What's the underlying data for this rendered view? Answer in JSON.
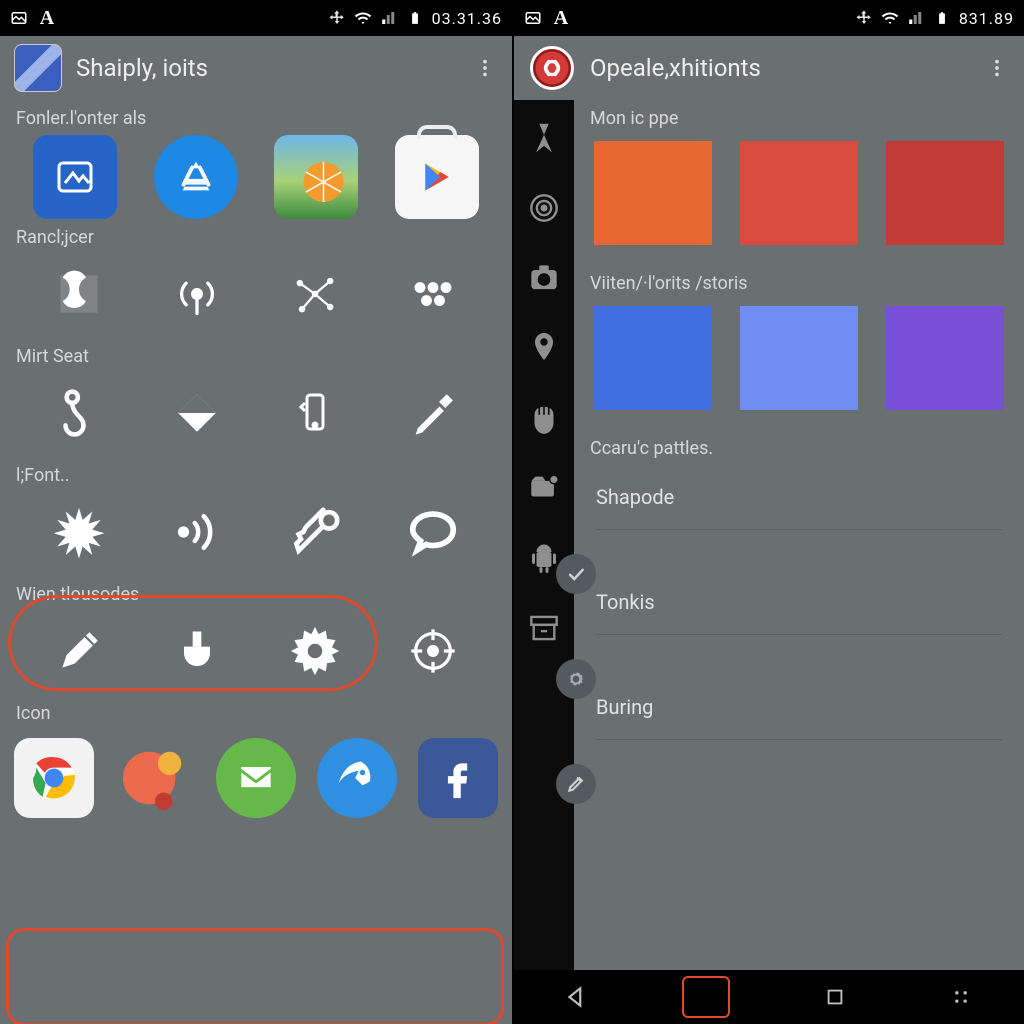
{
  "left": {
    "status_time": "03.31.36",
    "title": "Shaiply, ioits",
    "sections": {
      "folder_label": "Fonler.l'onter als",
      "randjcer_label": "Rancl;jcer",
      "mirt_label": "Mirt Seat",
      "font_label": "l;Font..",
      "wien_label": "Wien tlousodes",
      "icon_label": "Icon"
    }
  },
  "right": {
    "status_time": "831.89",
    "title": "Opeale,xhitionts",
    "sections": {
      "mon_label": "Mon ic ppe",
      "viten_label": "Viiten/·l'orits /storis",
      "caruc_label": "Ccaru'c pattles."
    },
    "prefs": {
      "shapode": "Shapode",
      "tonkis": "Tonkis",
      "buring": "Buring"
    },
    "swatches": {
      "row1": [
        "#e8662f",
        "#d84b40",
        "#c23b36"
      ],
      "row2": [
        "#3f6fe0",
        "#6f8df2",
        "#7a4fd8"
      ]
    }
  }
}
